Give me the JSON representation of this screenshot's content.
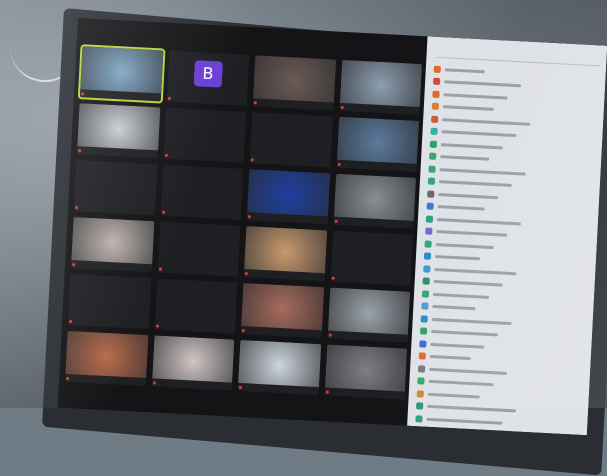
{
  "meeting": {
    "tiles": [
      {
        "name": "",
        "type": "video",
        "tone": "#7fa7c6",
        "active": true
      },
      {
        "name": "",
        "type": "avatar",
        "letter": "B"
      },
      {
        "name": "",
        "type": "video",
        "tone": "#6b5a55"
      },
      {
        "name": "",
        "type": "video",
        "tone": "#8d9fb0"
      },
      {
        "name": "",
        "type": "video",
        "tone": "#c9ced3"
      },
      {
        "name": "",
        "type": "name-only"
      },
      {
        "name": "",
        "type": "name-only"
      },
      {
        "name": "",
        "type": "video",
        "tone": "#5b7a9d"
      },
      {
        "name": "",
        "type": "name-only"
      },
      {
        "name": "",
        "type": "name-only"
      },
      {
        "name": "",
        "type": "video",
        "tone": "#1e3fa0"
      },
      {
        "name": "",
        "type": "video",
        "tone": "#8a8f94"
      },
      {
        "name": "",
        "type": "video",
        "tone": "#bfb3b0"
      },
      {
        "name": "",
        "type": "name-only"
      },
      {
        "name": "",
        "type": "video",
        "tone": "#c89a6e"
      },
      {
        "name": "",
        "type": "name-only"
      },
      {
        "name": "",
        "type": "name-only"
      },
      {
        "name": "",
        "type": "name-only"
      },
      {
        "name": "",
        "type": "video",
        "tone": "#a86b5c"
      },
      {
        "name": "",
        "type": "video",
        "tone": "#9aa3aa"
      },
      {
        "name": "",
        "type": "video",
        "tone": "#b96a4a"
      },
      {
        "name": "",
        "type": "video",
        "tone": "#d0c6c4"
      },
      {
        "name": "",
        "type": "video",
        "tone": "#cdd6dd"
      },
      {
        "name": "",
        "type": "video",
        "tone": "#7d7f82"
      }
    ],
    "letter_avatar_color": "#6c3fd6",
    "active_speaker_color": "#b7d23a",
    "muted_indicator_color": "#e23b3b"
  },
  "participants_panel": {
    "title": "",
    "avatar_colors": [
      "#e06b2c",
      "#d14b3a",
      "#e0692e",
      "#d9812f",
      "#cc5a3b",
      "#3bb0a1",
      "#2f9f70",
      "#3aaa6a",
      "#39a86c",
      "#36a77a",
      "#6a6a6a",
      "#3d7dd0",
      "#2aa38a",
      "#7a6ad0",
      "#35a77c",
      "#2a8fc6",
      "#3a9ad6",
      "#2d8f6f",
      "#3ca774",
      "#5a9ad0",
      "#2e8ec4",
      "#3aa06c",
      "#3f6ed0",
      "#e06b2c",
      "#7b7b7b",
      "#3aa86a",
      "#d08a2c",
      "#2f9a6f",
      "#35a27a",
      "#4a89d0"
    ]
  }
}
